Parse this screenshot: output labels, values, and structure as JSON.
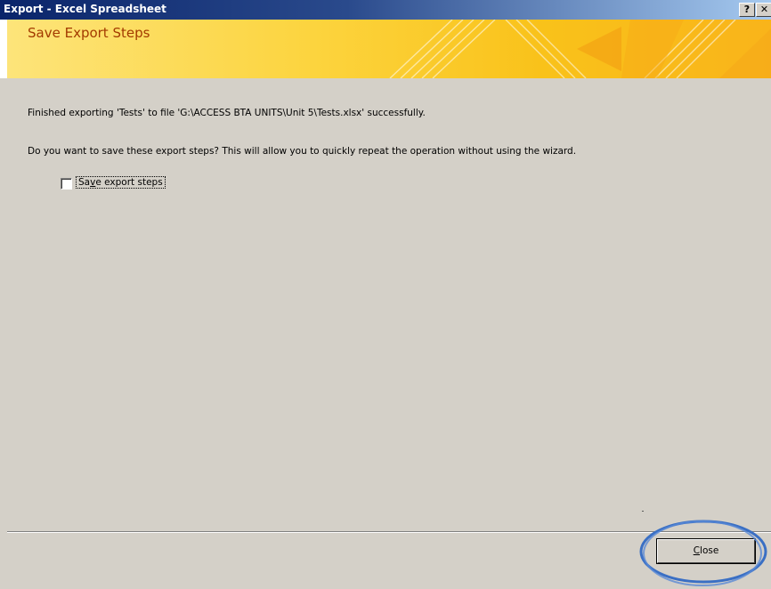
{
  "window": {
    "title": "Export - Excel Spreadsheet",
    "help_button": "?",
    "close_button": "✕"
  },
  "header": {
    "title": "Save Export Steps"
  },
  "content": {
    "finished_message": "Finished exporting 'Tests' to file 'G:\\ACCESS BTA UNITS\\Unit 5\\Tests.xlsx' successfully.",
    "question": "Do you want to save these export steps? This will allow you to quickly repeat the operation without using the wizard.",
    "save_steps_checkbox": {
      "label_before": "Sa",
      "label_accel": "v",
      "label_after": "e export steps",
      "checked": false
    }
  },
  "footer": {
    "close_label_accel": "C",
    "close_label_rest": "lose"
  },
  "colors": {
    "banner_title": "#a33a00",
    "banner_gold": "#fcd43e",
    "annotation_ring": "#3a6fc4",
    "dialog_face": "#d4d0c8"
  },
  "icons": {
    "help": "question-mark-icon",
    "close": "close-icon"
  }
}
